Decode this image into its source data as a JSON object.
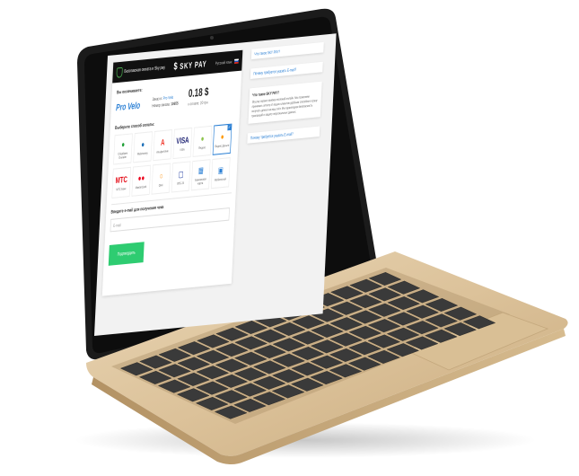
{
  "header": {
    "secure_label": "Безопасная оплата в Sky pay",
    "logo_text": "SKY PAY",
    "logo_symbol": "$",
    "lang_label": "Русский язык"
  },
  "payment": {
    "title": "Вы оплачиваете:",
    "merchant": "Pro Velo",
    "order_label": "Заказ в:",
    "order_merchant": "Pro Velo",
    "order_number_label": "Номер заказа:",
    "order_number": "10655",
    "amount": "0.18 $",
    "amount_sub": "к оплате: 20 грн"
  },
  "methods": {
    "title": "Выберите способ оплаты:",
    "items": [
      {
        "icon": "●",
        "label": "Сбербанк Онлайн",
        "color": "#21a038"
      },
      {
        "icon": "●",
        "label": "Webmoney",
        "color": "#1c6fb8"
      },
      {
        "icon": "А",
        "label": "Альфа-Клик",
        "color": "#ef3124"
      },
      {
        "icon": "VISA",
        "label": "VISA",
        "color": "#1a1f71"
      },
      {
        "icon": "●",
        "label": "Яндекс",
        "color": "#8bc34a"
      },
      {
        "icon": "●",
        "label": "Яндекс Деньги",
        "color": "#ff9800",
        "selected": true
      },
      {
        "icon": "МТС",
        "label": "МТС Банк",
        "color": "#e30611"
      },
      {
        "icon": "●●",
        "label": "MasterCard",
        "color": "#eb001b"
      },
      {
        "icon": "○",
        "label": "Qiwi",
        "color": "#ff8c00"
      },
      {
        "icon": "▢",
        "label": "ВТБ 24",
        "color": "#0a2896"
      },
      {
        "icon": "▦",
        "label": "Банковская карта",
        "color": "#2a7fd4"
      },
      {
        "icon": "▣",
        "label": "Мобильный",
        "color": "#2a7fd4"
      }
    ]
  },
  "email": {
    "title": "Введите e-mail для получения чека",
    "placeholder": "E-mail"
  },
  "confirm_label": "Подтвердить",
  "faq": {
    "btn1": "Что такое SKY PAY?",
    "btn2": "Почему требуется указать E-mail?",
    "card_question": "Что такое SKY PAY?",
    "card_answer": "Sky pay сервис приёма платежей онлайн. Мы позволяем принимать оплату от ваших клиентов удобным способом и сразу получать деньги на ваш счёт. Мы гарантируем безопасность транзакций и защиту персональных данных.",
    "btn3": "Почему требуется указать E-mail?"
  }
}
